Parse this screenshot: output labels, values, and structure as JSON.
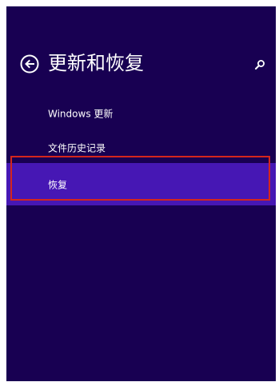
{
  "header": {
    "title": "更新和恢复",
    "back_icon": "back-arrow-circle-icon",
    "search_icon": "search-icon"
  },
  "nav": {
    "items": [
      {
        "label": "Windows 更新",
        "selected": false
      },
      {
        "label": "文件历史记录",
        "selected": false
      },
      {
        "label": "恢复",
        "selected": true
      }
    ]
  },
  "colors": {
    "background": "#180052",
    "selected_item": "#4617b4",
    "highlight_border": "#d4261d",
    "text": "#ffffff"
  }
}
